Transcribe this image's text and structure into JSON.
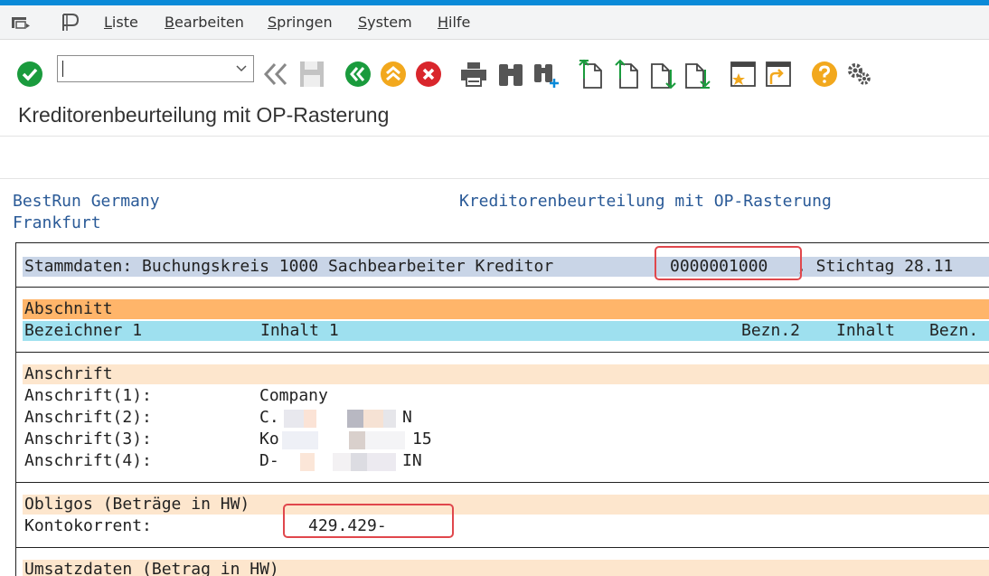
{
  "menu": {
    "items": [
      {
        "pre": "",
        "u": "L",
        "post": "iste"
      },
      {
        "pre": "",
        "u": "B",
        "post": "earbeiten"
      },
      {
        "pre": "",
        "u": "S",
        "post": "pringen"
      },
      {
        "pre": "",
        "u": "S",
        "post": "ystem"
      },
      {
        "pre": "",
        "u": "H",
        "post": "ilfe"
      }
    ]
  },
  "toolbar": {
    "command_value": ""
  },
  "page": {
    "title": "Kreditorenbeurteilung mit OP-Rasterung"
  },
  "report": {
    "company": "BestRun Germany",
    "city": "Frankfurt",
    "report_title": "Kreditorenbeurteilung mit OP-Rasterung",
    "stamm_prefix": "Stammdaten: Buchungskreis 1000 Sachbearbeiter Kreditor",
    "vendor_number": "0000001000",
    "stamm_suffix": ", Stichtag 28.11",
    "abschnitt": "Abschnitt",
    "col_bez1": "Bezeichner 1",
    "col_inhalt1": "Inhalt 1",
    "col_bez2": "Bezn.2",
    "col_inhalt": "Inhalt",
    "col_bezn": "Bezn.",
    "anschrift": "Anschrift",
    "addr": [
      {
        "label": "Anschrift(1):",
        "value": "Company"
      },
      {
        "label": "Anschrift(2):",
        "value": "C.",
        "tail": "N"
      },
      {
        "label": "Anschrift(3):",
        "value": "Ko",
        "tail": "15"
      },
      {
        "label": "Anschrift(4):",
        "value": "D-",
        "tail": "IN"
      }
    ],
    "obligos": "Obligos (Beträge in HW)",
    "kontokorrent_label": "Kontokorrent:",
    "kontokorrent_value": "429.429-",
    "umsatz": "Umsatzdaten (Betrag in HW)"
  },
  "colors": {
    "accent": "#0a8ad8",
    "orange_header": "#ffb56a",
    "blue_header": "#9ee0ef",
    "light_orange": "#fde6cd",
    "stamm_bg": "#c9d5e7",
    "highlight": "#e0474c"
  }
}
